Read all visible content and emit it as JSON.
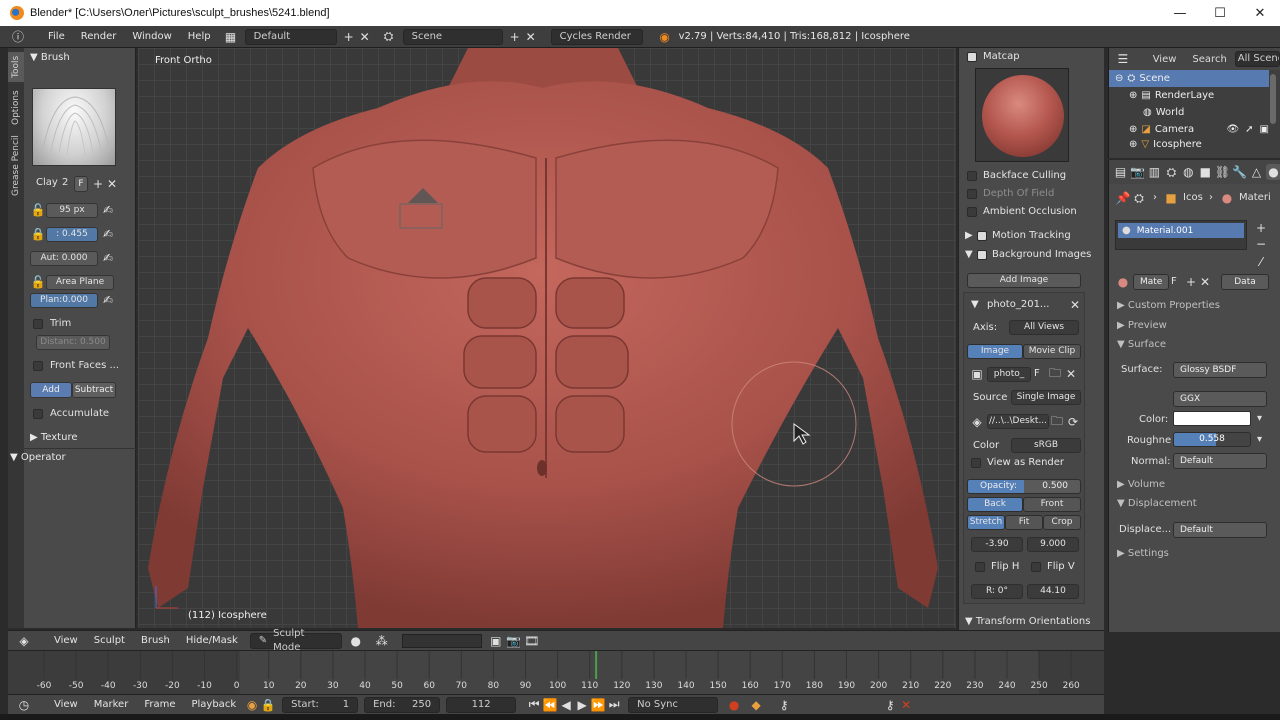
{
  "window": {
    "title": "Blender* [C:\\Users\\Олег\\Pictures\\sculpt_brushes\\5241.blend]",
    "minimize": "—",
    "maximize": "☐",
    "close": "✕"
  },
  "info_header": {
    "menus": [
      "File",
      "Render",
      "Window",
      "Help"
    ],
    "layout": "Default",
    "scene": "Scene",
    "engine": "Cycles Render",
    "stats": "v2.79 | Verts:84,410 | Tris:168,812 | Icosphere"
  },
  "tool_tabs": [
    "Tools",
    "Options",
    "Grease Pencil"
  ],
  "tool_shelf": {
    "brush_header": "Brush",
    "brush_name": "Clay",
    "brush_users": "2",
    "brush_fake": "F",
    "radius": "95 px",
    "strength": ": 0.455",
    "autosmooth": "Aut: 0.000",
    "sculpt_plane": "Area Plane",
    "plane_offset": "Plan:0.000",
    "trim_label": "Trim",
    "distance": "Distanc: 0.500",
    "front_faces": "Front Faces ...",
    "add_label": "Add",
    "subtract_label": "Subtract",
    "accumulate": "Accumulate",
    "texture_header": "Texture",
    "operator_header": "Operator"
  },
  "viewport": {
    "view_name": "Front Ortho",
    "object_info": "(112) Icosphere"
  },
  "n_panel": {
    "matcap": "Matcap",
    "backface_culling": "Backface Culling",
    "depth_of_field": "Depth Of Field",
    "ambient_occlusion": "Ambient Occlusion",
    "motion_tracking": "Motion Tracking",
    "background_images": "Background Images",
    "add_image": "Add Image",
    "image_name": "photo_201...",
    "axis_label": "Axis:",
    "axis_value": "All Views",
    "tab_image": "Image",
    "tab_movie": "Movie Clip",
    "image_field": "photo_",
    "image_fake": "F",
    "source_label": "Source",
    "source_value": "Single Image",
    "filepath": "//..\\..\\Deskt...",
    "color_label": "Color",
    "color_value": "sRGB",
    "view_as_render": "View as Render",
    "opacity_label": "Opacity:",
    "opacity_value": "0.500",
    "opacity_fraction": 0.5,
    "back": "Back",
    "front": "Front",
    "stretch": "Stretch",
    "fit": "Fit",
    "crop": "Crop",
    "offset_x": "-3.90",
    "offset_y": "9.000",
    "flip_h": "Flip H",
    "flip_v": "Flip V",
    "rotation": "R: 0°",
    "size": "44.10",
    "transform_orientations": "Transform Orientations"
  },
  "outliner": {
    "view": "View",
    "search": "Search",
    "all_scenes": "All Scene",
    "rows": [
      "Scene",
      "RenderLaye",
      "World",
      "Camera",
      "Icosphere"
    ]
  },
  "properties": {
    "breadcrumb_obj": "Icos",
    "breadcrumb_mat": "Materi",
    "material_slot": "Material.001",
    "material_name": "Mate",
    "material_fake": "F",
    "link": "Data",
    "custom_properties": "Custom Properties",
    "preview": "Preview",
    "surface_header": "Surface",
    "surface_label": "Surface:",
    "surface_value": "Glossy BSDF",
    "distribution": "GGX",
    "color_label": "Color:",
    "color_swatch": "#ffffff",
    "roughness_label": "Roughne",
    "roughness_value": "0.558",
    "roughness_fraction": 0.558,
    "normal_label": "Normal:",
    "normal_value": "Default",
    "volume": "Volume",
    "displacement": "Displacement",
    "displacement_label": "Displace...",
    "displacement_value": "Default",
    "settings": "Settings"
  },
  "view_header": {
    "menus": [
      "View",
      "Sculpt",
      "Brush",
      "Hide/Mask"
    ],
    "mode": "Sculpt Mode"
  },
  "timeline": {
    "ticks": [
      "-60",
      "-50",
      "-40",
      "-30",
      "-20",
      "-10",
      "0",
      "10",
      "20",
      "30",
      "40",
      "50",
      "60",
      "70",
      "80",
      "90",
      "100",
      "110",
      "120",
      "130",
      "140",
      "150",
      "160",
      "170",
      "180",
      "190",
      "200",
      "210",
      "220",
      "230",
      "240",
      "250",
      "260"
    ],
    "current_frame_marker": 112
  },
  "timeline_header": {
    "menus": [
      "View",
      "Marker",
      "Frame",
      "Playback"
    ],
    "start_label": "Start:",
    "start_value": "1",
    "end_label": "End:",
    "end_value": "250",
    "current": "112",
    "sync": "No Sync"
  },
  "colors": {
    "accent_blue": "#5680b8",
    "skin": "#b0584f"
  }
}
